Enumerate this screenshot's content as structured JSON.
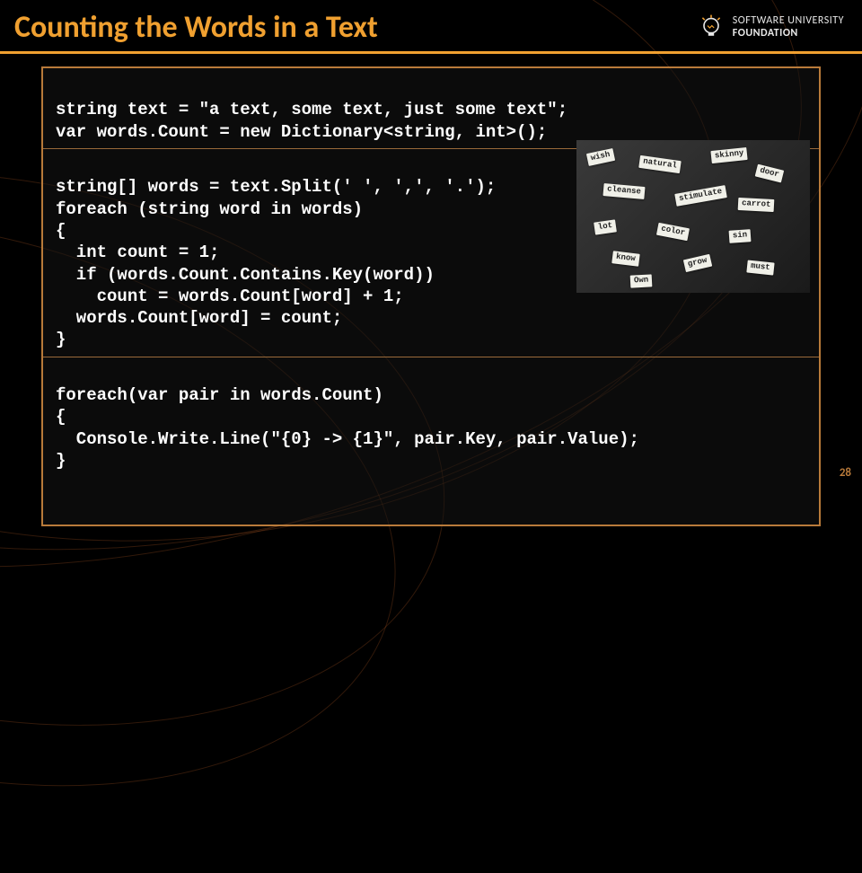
{
  "title": "Counting the Words in a Text",
  "logo": {
    "line1": "SOFTWARE UNIVERSITY",
    "line2": "FOUNDATION"
  },
  "code": {
    "block1_l1": "string text = \"a text, some text, just some text\";",
    "block1_l2": "var words.Count = new Dictionary<string, int>();",
    "block2_l1": "string[] words = text.Split(' ', ',', '.');",
    "block2_l2": "foreach (string word in words)",
    "block2_l3": "{",
    "block2_l4": "  int count = 1;",
    "block2_l5": "  if (words.Count.Contains.Key(word))",
    "block2_l6": "    count = words.Count[word] + 1;",
    "block2_l7": "  words.Count[word] = count;",
    "block2_l8": "}",
    "block3_l1": "foreach(var pair in words.Count)",
    "block3_l2": "{",
    "block3_l3": "  Console.Write.Line(\"{0} -> {1}\", pair.Key, pair.Value);",
    "block3_l4": "}"
  },
  "image_alt": "word-clippings-photo",
  "clips": [
    "wish",
    "natural",
    "skinny",
    "door",
    "cleanse",
    "stimulate",
    "carrot",
    "lot",
    "color",
    "sin",
    "know",
    "grow",
    "must",
    "Own"
  ],
  "page_number": "28"
}
